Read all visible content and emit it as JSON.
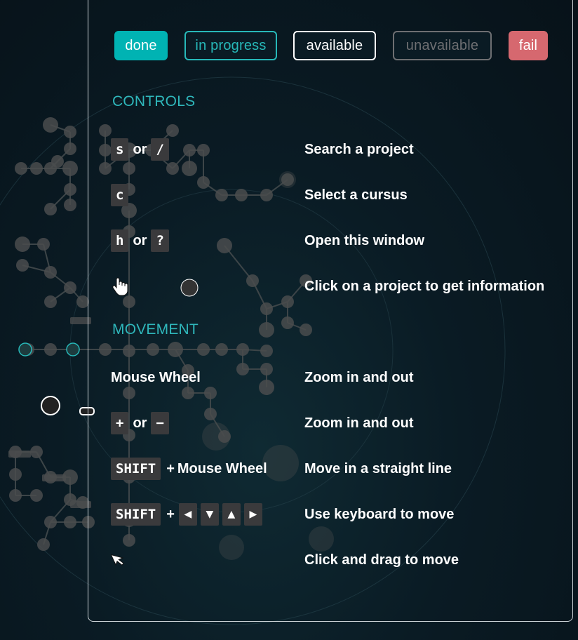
{
  "status_badges": [
    {
      "label": "done"
    },
    {
      "label": "in progress"
    },
    {
      "label": "available"
    },
    {
      "label": "unavailable"
    },
    {
      "label": "fail"
    }
  ],
  "colors": {
    "done": "#00b3b3",
    "in_progress": "#27b9b9",
    "available": "#ffffff",
    "unavailable": "#6e6f72",
    "fail": "#d6686f",
    "section_title": "#2fb7bb",
    "key_bg": "#3a3a3c"
  },
  "controls": {
    "title": "CONTROLS",
    "rows": [
      {
        "keys": [
          "s",
          "/"
        ],
        "joiner": "or",
        "desc": "Search a project"
      },
      {
        "keys": [
          "c"
        ],
        "desc": "Select a cursus"
      },
      {
        "keys": [
          "h",
          "?"
        ],
        "joiner": "or",
        "desc": "Open this window"
      },
      {
        "icon": "hand-pointer-icon",
        "desc": "Click on a project to get information"
      }
    ]
  },
  "movement": {
    "title": "MOVEMENT",
    "rows": [
      {
        "text": "Mouse Wheel",
        "desc": "Zoom in and out"
      },
      {
        "keys": [
          "+",
          "−"
        ],
        "joiner": "or",
        "desc": "Zoom in and out"
      },
      {
        "keys": [
          "SHIFT"
        ],
        "plus": "+",
        "text": "Mouse Wheel",
        "desc": "Move in a straight line"
      },
      {
        "keys": [
          "SHIFT"
        ],
        "plus": "+",
        "arrows": [
          "◀",
          "▼",
          "▲",
          "▶"
        ],
        "desc": "Use keyboard to move"
      },
      {
        "icon": "arrow-cursor-icon",
        "desc": "Click and drag to move"
      }
    ]
  }
}
